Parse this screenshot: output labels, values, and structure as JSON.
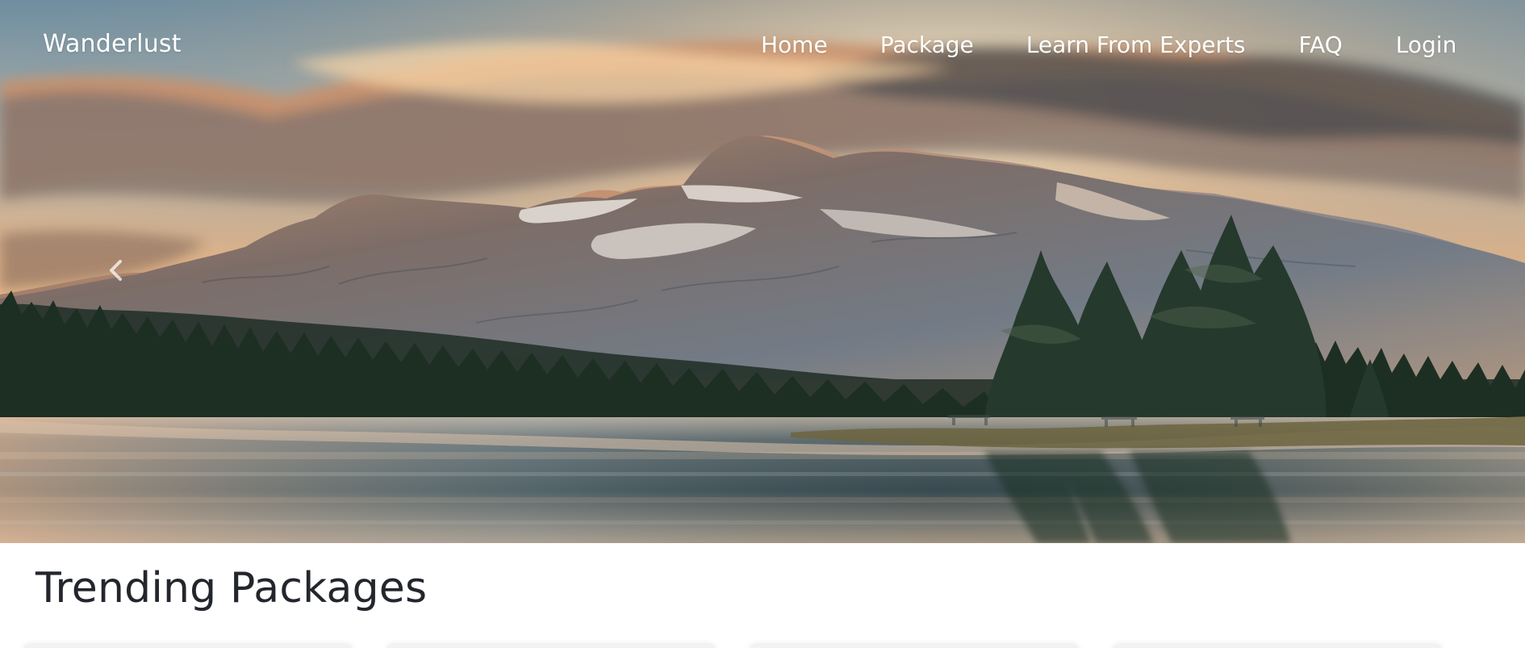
{
  "brand": {
    "name": "Wanderlust"
  },
  "nav": {
    "items": [
      {
        "label": "Home"
      },
      {
        "label": "Package"
      },
      {
        "label": "Learn From Experts"
      },
      {
        "label": "FAQ"
      },
      {
        "label": "Login"
      }
    ]
  },
  "hero": {
    "carousel_previous_icon": "chevron-left-icon"
  },
  "main": {
    "section_title": "Trending Packages"
  },
  "colors": {
    "text_white": "#ffffff",
    "heading": "#23262c",
    "background": "#ffffff"
  }
}
